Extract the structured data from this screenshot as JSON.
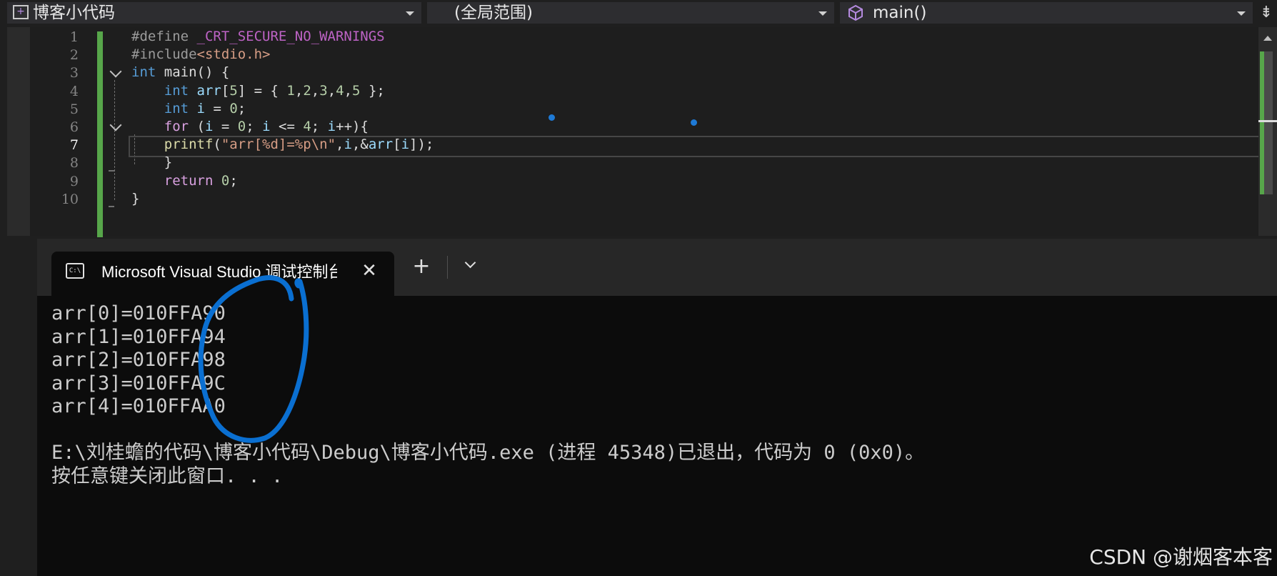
{
  "navbar": {
    "project": "博客小代码",
    "scope": "(全局范围)",
    "function": "main()"
  },
  "editor": {
    "line_numbers": [
      "1",
      "2",
      "3",
      "4",
      "5",
      "6",
      "7",
      "8",
      "9",
      "10"
    ],
    "current_line": 7,
    "lines": [
      [
        {
          "t": "#define ",
          "c": "pp"
        },
        {
          "t": "_CRT_SECURE_NO_WARNINGS",
          "c": "mac"
        }
      ],
      [
        {
          "t": "#include",
          "c": "pp"
        },
        {
          "t": "<stdio.h>",
          "c": "str"
        }
      ],
      [
        {
          "t": "int",
          "c": "k"
        },
        {
          "t": " main() {",
          "c": ""
        }
      ],
      [
        {
          "t": "    ",
          "c": ""
        },
        {
          "t": "int",
          "c": "k"
        },
        {
          "t": " ",
          "c": ""
        },
        {
          "t": "arr",
          "c": "var"
        },
        {
          "t": "[",
          "c": ""
        },
        {
          "t": "5",
          "c": "num"
        },
        {
          "t": "] = { ",
          "c": ""
        },
        {
          "t": "1",
          "c": "num"
        },
        {
          "t": ",",
          "c": ""
        },
        {
          "t": "2",
          "c": "num"
        },
        {
          "t": ",",
          "c": ""
        },
        {
          "t": "3",
          "c": "num"
        },
        {
          "t": ",",
          "c": ""
        },
        {
          "t": "4",
          "c": "num"
        },
        {
          "t": ",",
          "c": ""
        },
        {
          "t": "5",
          "c": "num"
        },
        {
          "t": " };",
          "c": ""
        }
      ],
      [
        {
          "t": "    ",
          "c": ""
        },
        {
          "t": "int",
          "c": "k"
        },
        {
          "t": " ",
          "c": ""
        },
        {
          "t": "i",
          "c": "var"
        },
        {
          "t": " = ",
          "c": ""
        },
        {
          "t": "0",
          "c": "num"
        },
        {
          "t": ";",
          "c": ""
        }
      ],
      [
        {
          "t": "    ",
          "c": ""
        },
        {
          "t": "for",
          "c": "ret"
        },
        {
          "t": " (",
          "c": ""
        },
        {
          "t": "i",
          "c": "var"
        },
        {
          "t": " = ",
          "c": ""
        },
        {
          "t": "0",
          "c": "num"
        },
        {
          "t": "; ",
          "c": ""
        },
        {
          "t": "i",
          "c": "var"
        },
        {
          "t": " <= ",
          "c": ""
        },
        {
          "t": "4",
          "c": "num"
        },
        {
          "t": "; ",
          "c": ""
        },
        {
          "t": "i",
          "c": "var"
        },
        {
          "t": "++){",
          "c": ""
        }
      ],
      [
        {
          "t": "    ",
          "c": ""
        },
        {
          "t": "printf",
          "c": "fn"
        },
        {
          "t": "(",
          "c": ""
        },
        {
          "t": "\"arr[%d]=%p\\n\"",
          "c": "str"
        },
        {
          "t": ",",
          "c": ""
        },
        {
          "t": "i",
          "c": "var"
        },
        {
          "t": ",&",
          "c": ""
        },
        {
          "t": "arr",
          "c": "var"
        },
        {
          "t": "[",
          "c": ""
        },
        {
          "t": "i",
          "c": "var"
        },
        {
          "t": "]);",
          "c": ""
        }
      ],
      [
        {
          "t": "    }",
          "c": ""
        }
      ],
      [
        {
          "t": "    ",
          "c": ""
        },
        {
          "t": "return",
          "c": "ret"
        },
        {
          "t": " ",
          "c": ""
        },
        {
          "t": "0",
          "c": "num"
        },
        {
          "t": ";",
          "c": ""
        }
      ],
      [
        {
          "t": "}",
          "c": ""
        }
      ]
    ]
  },
  "terminal": {
    "tab_title": "Microsoft Visual Studio 调试控制台",
    "icon_text": "C:\\",
    "output": [
      "arr[0]=010FFA90",
      "arr[1]=010FFA94",
      "arr[2]=010FFA98",
      "arr[3]=010FFA9C",
      "arr[4]=010FFAA0",
      "",
      "E:\\刘桂蟾的代码\\博客小代码\\Debug\\博客小代码.exe (进程 45348)已退出，代码为 0 (0x0)。",
      "按任意键关闭此窗口. . ."
    ]
  },
  "watermark": "CSDN @谢烟客本客",
  "colors": {
    "annotation_stroke": "#0a6fd1",
    "change_bar": "#57a64a",
    "terminal_bg": "#0c0c0c"
  }
}
